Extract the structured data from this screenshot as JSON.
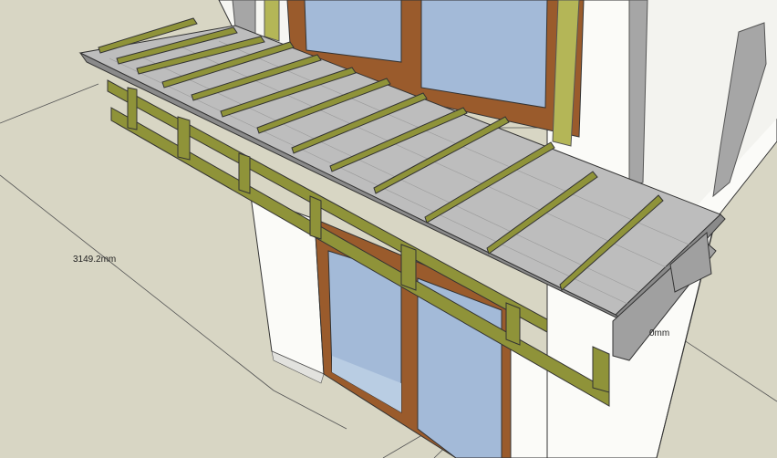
{
  "dimensions": {
    "left_label": "3149.2mm",
    "right_label": "0mm"
  },
  "colors": {
    "ground": "#d8d6c4",
    "wall": "#fbfbf8",
    "wall_shadow": "#e2e2de",
    "glass": "#a3bad8",
    "window_frame": "#9a5b2c",
    "timber": "#8f9339",
    "timber_light": "#b4b657",
    "roof_sheet": "#bdbdbd",
    "roof_edge": "#8a8a8a",
    "steel": "#a0a0a0"
  }
}
